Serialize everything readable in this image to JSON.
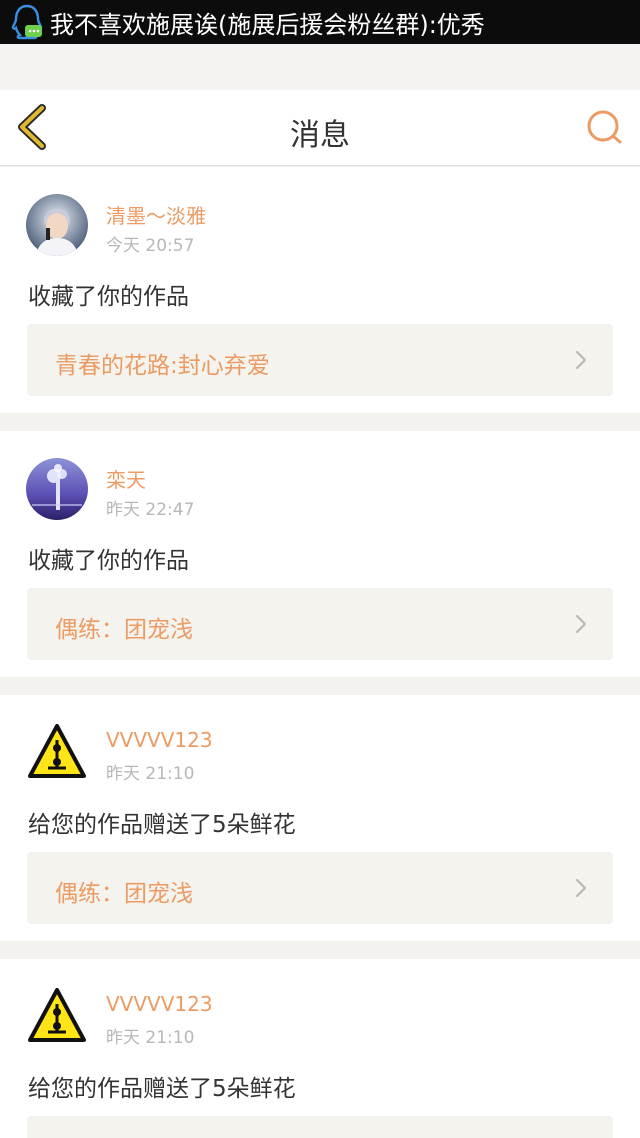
{
  "notification": {
    "text": "我不喜欢施展诶(施展后援会粉丝群):优秀",
    "app_icon": "qq-penguin-icon"
  },
  "navbar": {
    "title": "消息",
    "back_icon": "chevron-left-icon",
    "search_icon": "search-icon"
  },
  "colors": {
    "accent": "#eb9b63",
    "back_arrow": "#e0b92e",
    "text": "#333333",
    "muted": "#b7b7b7",
    "page_bg": "#f3f2ee"
  },
  "messages": [
    {
      "user": "清墨～淡雅",
      "time": "今天 20:57",
      "action": "收藏了你的作品",
      "work": "青春的花路:封心弃爱",
      "avatar_icon": "user-avatar-photo"
    },
    {
      "user": "栾天",
      "time": "昨天 22:47",
      "action": "收藏了你的作品",
      "work": "偶练：团宠浅",
      "avatar_icon": "user-avatar-photo"
    },
    {
      "user": "VVVVV123",
      "time": "昨天 21:10",
      "action": "给您的作品赠送了5朵鲜花",
      "work": "偶练：团宠浅",
      "avatar_icon": "warning-sign-avatar"
    },
    {
      "user": "VVVVV123",
      "time": "昨天 21:10",
      "action": "给您的作品赠送了5朵鲜花",
      "work": "",
      "avatar_icon": "warning-sign-avatar"
    }
  ]
}
